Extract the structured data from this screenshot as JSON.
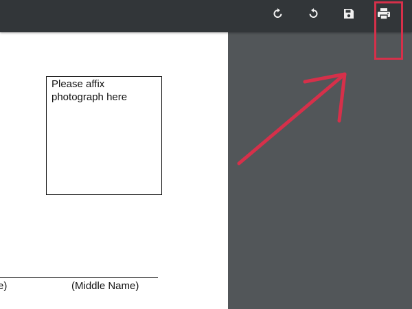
{
  "toolbar": {
    "buttons": [
      {
        "name": "rotate-clockwise",
        "icon": "rotate-clockwise-icon"
      },
      {
        "name": "rotate-counterclockwise",
        "icon": "rotate-counterclockwise-icon"
      },
      {
        "name": "save",
        "icon": "save-icon"
      },
      {
        "name": "print",
        "icon": "print-icon"
      }
    ]
  },
  "document": {
    "photo_box_text": "Please affix photograph here",
    "name_labels": {
      "first": "e)",
      "middle": "(Middle Name)"
    }
  },
  "annotation": {
    "color": "#d6304a",
    "target": "print-button"
  },
  "colors": {
    "toolbar": "#323639",
    "viewer_background": "#525659",
    "page": "#ffffff",
    "icon": "#f1f1f1"
  }
}
